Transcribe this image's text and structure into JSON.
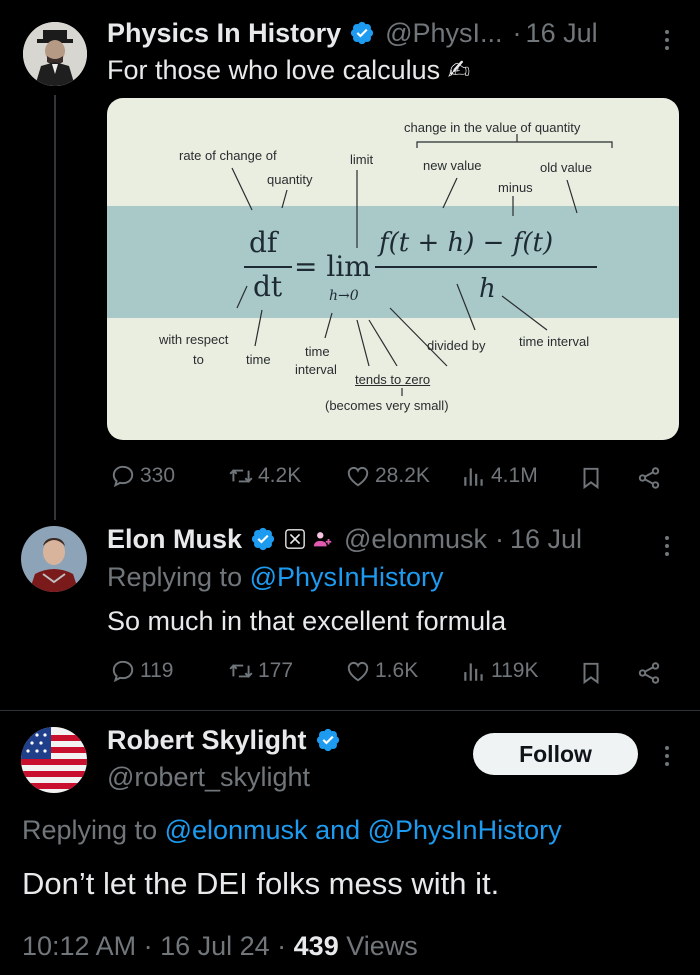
{
  "tweet1": {
    "name": "Physics In History",
    "handle": "@PhysI...",
    "date": "16 Jul",
    "text": "For those who love calculus ✍",
    "stats": {
      "replies": "330",
      "retweets": "4.2K",
      "likes": "28.2K",
      "views": "4.1M"
    },
    "card": {
      "labels": {
        "change": "change in the value of quantity",
        "rate1": "rate of change of",
        "rate2": "quantity",
        "limit": "limit",
        "new_value": "new value",
        "old_value": "old value",
        "minus": "minus",
        "with_respect1": "with respect",
        "with_respect2": "to",
        "time": "time",
        "time_interval1": "time",
        "time_interval2": "interval",
        "tends_to_zero": "tends to zero",
        "becomes_small": "(becomes very small)",
        "divided_by": "divided by",
        "time_interval_right": "time interval"
      },
      "formula": {
        "df": "df",
        "dt": "dt",
        "equals_lim": "= lim",
        "h_to_0": "h→0",
        "numerator": "f(t + h) − f(t)",
        "denominator": "h"
      }
    }
  },
  "tweet2": {
    "name": "Elon Musk",
    "handle": "@elonmusk",
    "date": "16 Jul",
    "replying_prefix": "Replying to ",
    "replying_to": "@PhysInHistory",
    "text": "So much in that excellent formula",
    "stats": {
      "replies": "119",
      "retweets": "177",
      "likes": "1.6K",
      "views": "119K"
    }
  },
  "tweet3": {
    "name": "Robert Skylight",
    "handle": "@robert_skylight",
    "follow_label": "Follow",
    "replying_prefix": "Replying to ",
    "replying_to_1": "@elonmusk",
    "replying_and": " and ",
    "replying_to_2": "@PhysInHistory",
    "text": "Don’t let the DEI folks mess with it.",
    "time": "10:12 AM · 16 Jul 24 · ",
    "views_count": "439",
    "views_label": " Views"
  },
  "colors": {
    "background": "#000000",
    "text": "#e7e9ea",
    "secondary": "#71767b",
    "link": "#1d9bf0",
    "verified": "#1d9bf0",
    "divider": "#333639"
  },
  "icons": [
    "verified-badge-icon",
    "reply-icon",
    "retweet-icon",
    "like-icon",
    "views-icon",
    "bookmark-icon",
    "share-icon",
    "more-icon",
    "x-affiliate-icon",
    "team-icon"
  ]
}
